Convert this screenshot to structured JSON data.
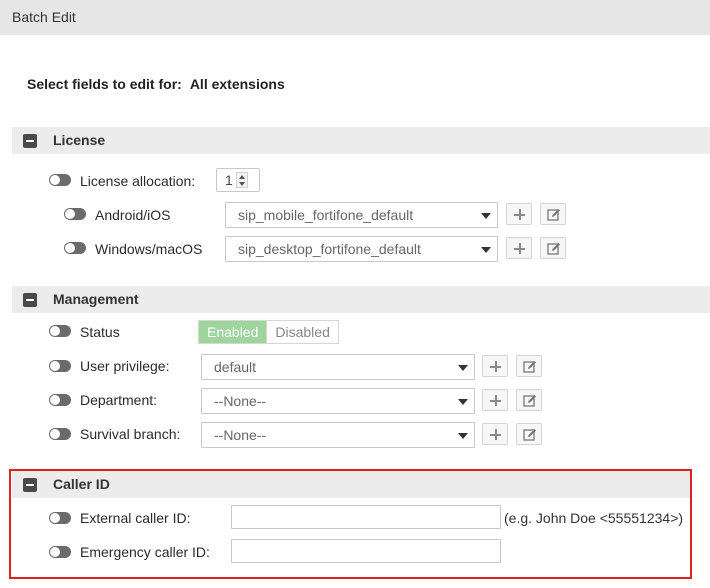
{
  "window": {
    "title": "Batch Edit"
  },
  "header": {
    "prefix": "Select fields to edit for:",
    "scope": "All extensions"
  },
  "license": {
    "title": "License",
    "allocation_label": "License allocation:",
    "allocation_value": "1",
    "android_label": "Android/iOS",
    "android_value": "sip_mobile_fortifone_default",
    "windows_label": "Windows/macOS",
    "windows_value": "sip_desktop_fortifone_default"
  },
  "management": {
    "title": "Management",
    "status_label": "Status",
    "status_options": [
      "Enabled",
      "Disabled"
    ],
    "privilege_label": "User privilege:",
    "privilege_value": "default",
    "department_label": "Department:",
    "department_value": "--None--",
    "branch_label": "Survival branch:",
    "branch_value": "--None--"
  },
  "caller_id": {
    "title": "Caller ID",
    "external_label": "External caller ID:",
    "external_value": "",
    "external_hint": "(e.g. John Doe <55551234>)",
    "emergency_label": "Emergency caller ID:",
    "emergency_value": ""
  },
  "colors": {
    "accent_enabled": "#9fd49f",
    "highlight": "#dd2222",
    "section_bg": "#ececec"
  },
  "icons": [
    "collapse-icon",
    "toggle-icon",
    "chevron-down-icon",
    "plus-icon",
    "edit-icon"
  ]
}
